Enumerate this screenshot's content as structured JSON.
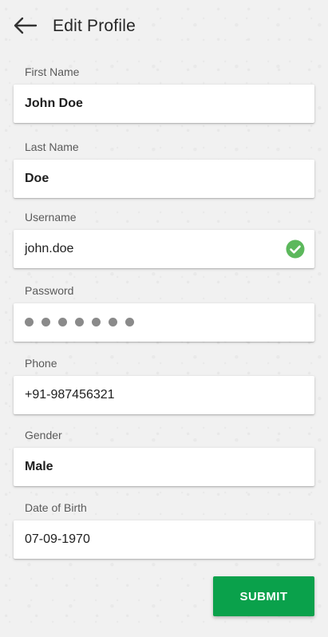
{
  "header": {
    "back_icon": "arrow-left-icon",
    "title": "Edit Profile"
  },
  "fields": {
    "first_name": {
      "label": "First Name",
      "value": "John Doe"
    },
    "last_name": {
      "label": "Last Name",
      "value": "Doe"
    },
    "username": {
      "label": "Username",
      "value": "john.doe",
      "status_icon": "check-circle-icon",
      "status_color": "#5cb85c"
    },
    "password": {
      "label": "Password",
      "masked_length": 7
    },
    "phone": {
      "label": "Phone",
      "value": "+91-987456321"
    },
    "gender": {
      "label": "Gender",
      "value": "Male"
    },
    "dob": {
      "label": "Date of Birth",
      "value": "07-09-1970"
    }
  },
  "submit": {
    "label": "SUBMIT",
    "color": "#0aa14b"
  }
}
